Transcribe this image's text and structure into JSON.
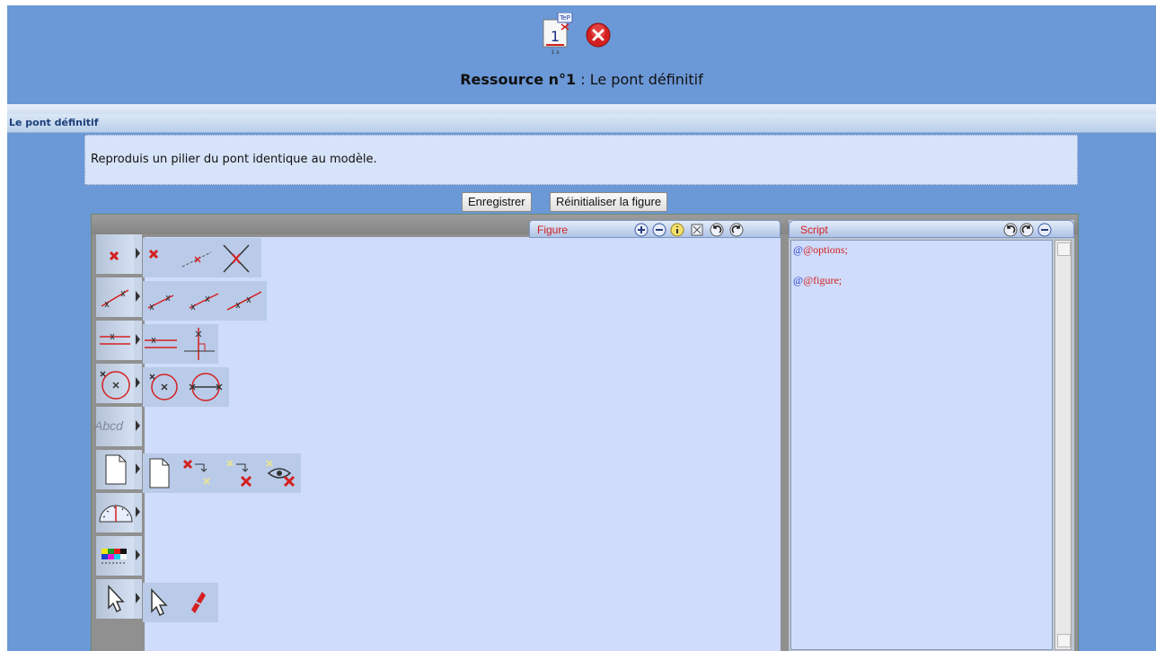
{
  "header": {
    "logo_number": "1",
    "logo_badge": "TeP",
    "logo_caption": "1 x",
    "title_bold": "Ressource n°1",
    "title_sep": " : ",
    "title_rest": "Le pont définitif"
  },
  "section": {
    "title": "Le pont définitif"
  },
  "consigne": {
    "text": "Reproduis un pilier du pont identique au modèle."
  },
  "buttons": {
    "save": "Enregistrer",
    "reset": "Réinitialiser la figure"
  },
  "figure_panel": {
    "title": "Figure"
  },
  "script_panel": {
    "title": "Script",
    "lines": [
      "@options;",
      "@figure;"
    ]
  },
  "toolbar": {
    "text_tool_label": "Abcd"
  },
  "colors": {
    "background": "#6b98d6",
    "panel": "#cfdcfb",
    "accent_red": "#d42020"
  }
}
